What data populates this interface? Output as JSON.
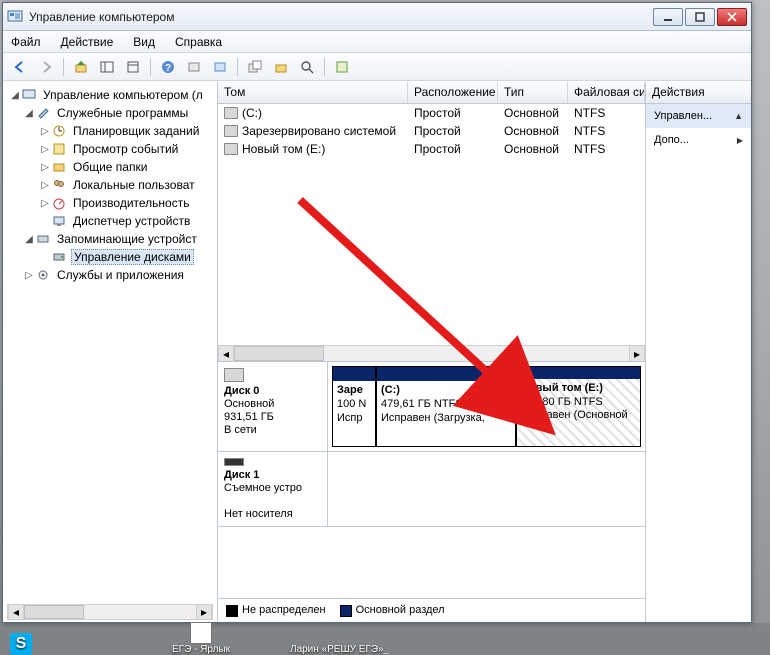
{
  "window": {
    "title": "Управление компьютером"
  },
  "menu": {
    "file": "Файл",
    "action": "Действие",
    "view": "Вид",
    "help": "Справка"
  },
  "tree": {
    "root": "Управление компьютером (л",
    "tools": "Служебные программы",
    "scheduler": "Планировщик заданий",
    "eventv": "Просмотр событий",
    "shared": "Общие папки",
    "users": "Локальные пользоват",
    "perf": "Производительность",
    "devmgr": "Диспетчер устройств",
    "storage": "Запоминающие устройст",
    "diskmgmt": "Управление дисками",
    "services": "Службы и приложения"
  },
  "grid": {
    "cols": {
      "volume": "Том",
      "layout": "Расположение",
      "type": "Тип",
      "fs": "Файловая сист"
    },
    "rows": [
      {
        "name": "(C:)",
        "layout": "Простой",
        "type": "Основной",
        "fs": "NTFS"
      },
      {
        "name": "Зарезервировано системой",
        "layout": "Простой",
        "type": "Основной",
        "fs": "NTFS"
      },
      {
        "name": "Новый том (E:)",
        "layout": "Простой",
        "type": "Основной",
        "fs": "NTFS"
      }
    ]
  },
  "disks": {
    "d0": {
      "label": "Диск 0",
      "type": "Основной",
      "size": "931,51 ГБ",
      "status": "В сети"
    },
    "d1": {
      "label": "Диск 1",
      "type": "Съемное устро",
      "status": "Нет носителя"
    },
    "parts": {
      "sr": {
        "title": "Заре",
        "l2": "100 N",
        "l3": "Испр"
      },
      "c": {
        "title": "(C:)",
        "l2": "479,61 ГБ NTFS",
        "l3": "Исправен (Загрузка,"
      },
      "e": {
        "title": "Новый том  (E:)",
        "l2": "451,80 ГБ NTFS",
        "l3": "Исправен (Основной"
      }
    }
  },
  "legend": {
    "unalloc": "Не распределен",
    "primary": "Основной раздел"
  },
  "actions": {
    "title": "Действия",
    "manage": "Управлен...",
    "more": "Допо..."
  },
  "taskbar": {
    "shortcut": "ЕГЭ - Ярлык",
    "larin": "Ларин «РЕШУ ЕГЭ»_"
  }
}
